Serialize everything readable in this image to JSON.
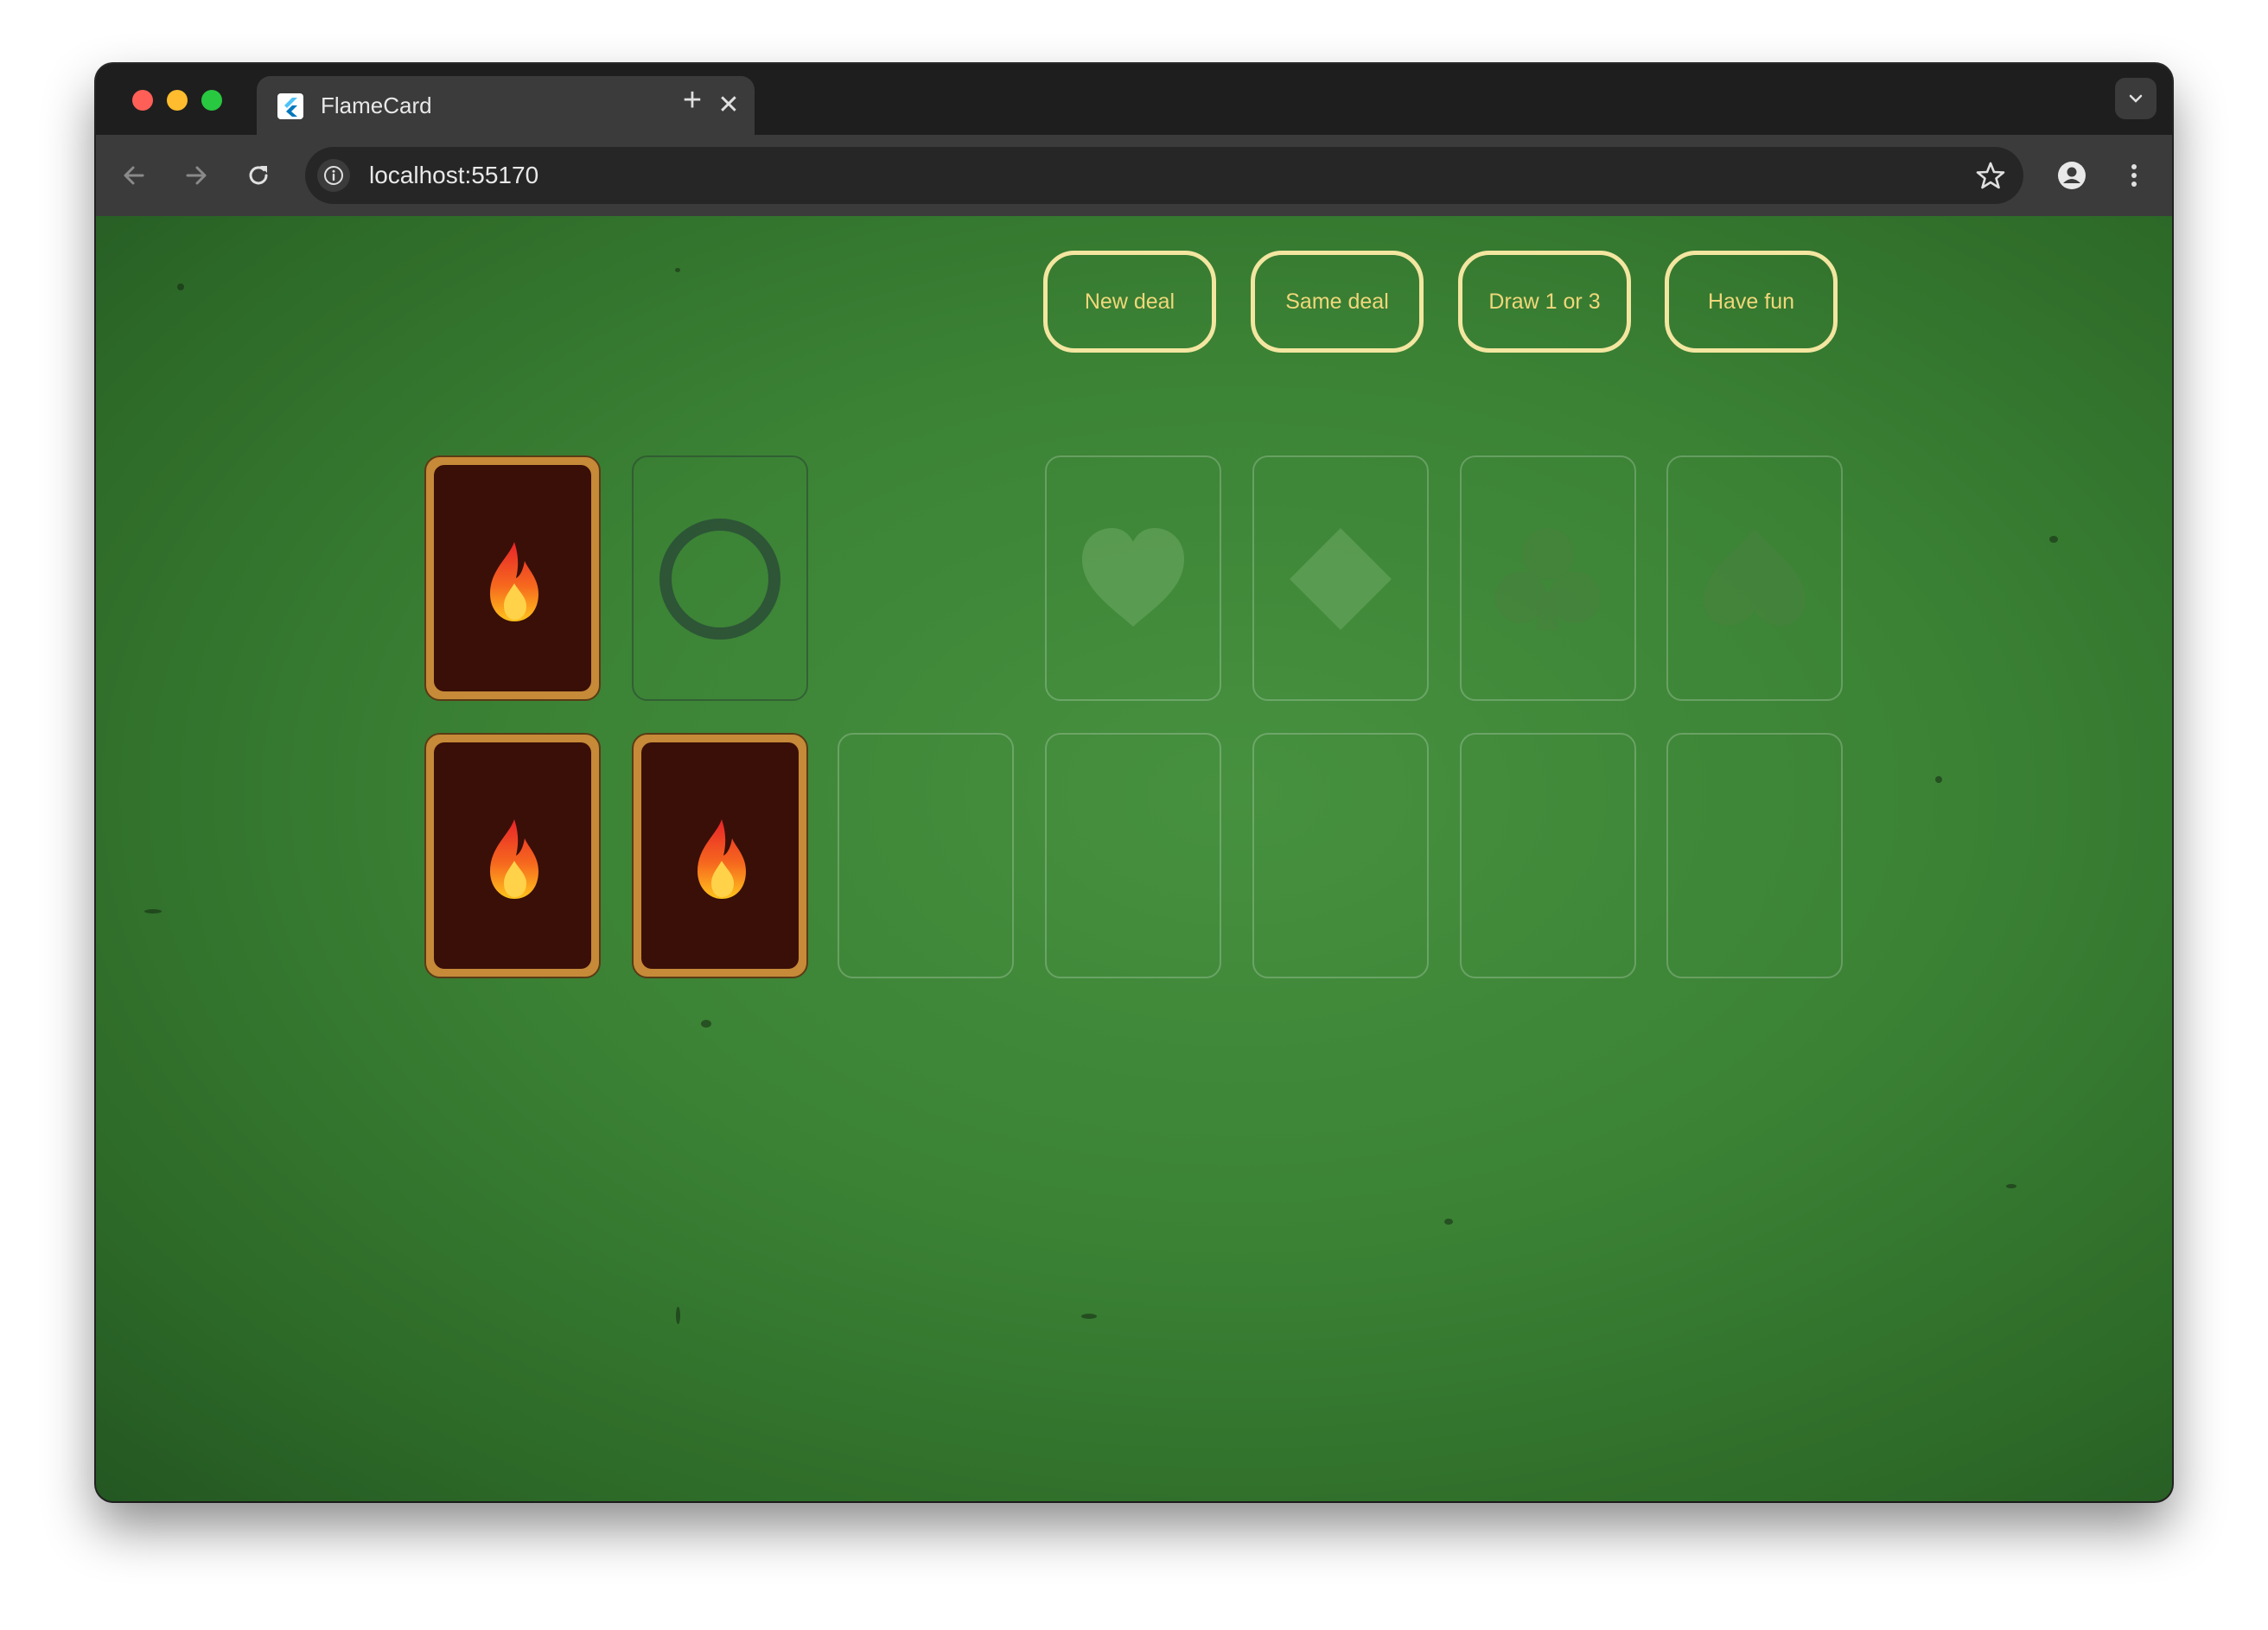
{
  "browser": {
    "tab_title": "FlameCard",
    "tab_close_glyph": "✕",
    "new_tab_glyph": "+",
    "url": "localhost:55170",
    "icons": [
      "flutter-favicon",
      "back-arrow-icon",
      "forward-arrow-icon",
      "reload-icon",
      "info-icon",
      "bookmark-star-icon",
      "profile-icon",
      "more-vert-icon",
      "tab-dropdown-icon"
    ]
  },
  "game": {
    "buttons": [
      {
        "label": "New deal"
      },
      {
        "label": "Same deal"
      },
      {
        "label": "Draw 1 or 3"
      },
      {
        "label": "Have fun"
      }
    ],
    "foundations": [
      "hearts",
      "diamonds",
      "clubs",
      "spades"
    ],
    "stock": "card-back-flame",
    "waste": "empty-ring",
    "tableau": [
      "card-back",
      "card-back",
      "empty",
      "empty",
      "empty",
      "empty",
      "empty"
    ],
    "colors": {
      "felt": "#3b8235",
      "button_border": "#f3e6a0",
      "button_text": "#f0d77a",
      "card_back": "#3a0f08",
      "card_border": "#c68a38"
    }
  }
}
